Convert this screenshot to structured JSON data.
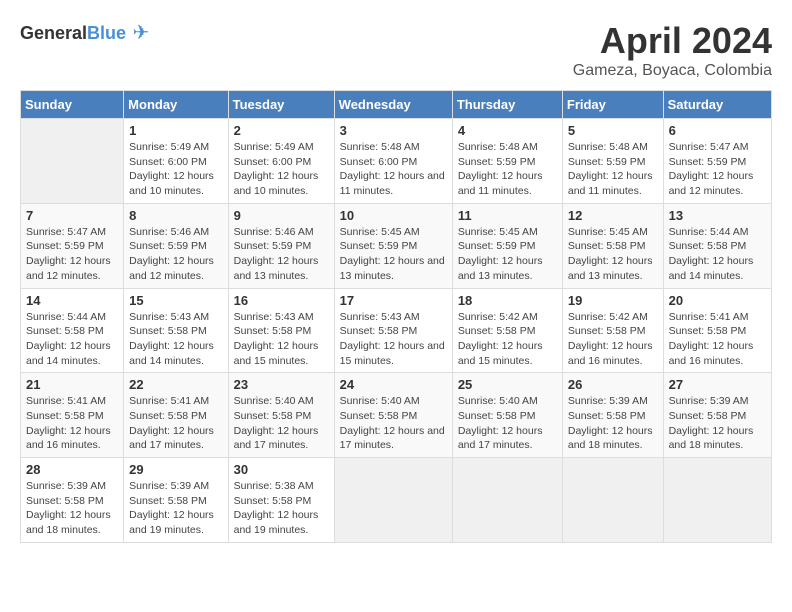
{
  "header": {
    "logo_general": "General",
    "logo_blue": "Blue",
    "month_year": "April 2024",
    "location": "Gameza, Boyaca, Colombia"
  },
  "days_of_week": [
    "Sunday",
    "Monday",
    "Tuesday",
    "Wednesday",
    "Thursday",
    "Friday",
    "Saturday"
  ],
  "weeks": [
    [
      {
        "day": "",
        "empty": true
      },
      {
        "day": "1",
        "sunrise": "5:49 AM",
        "sunset": "6:00 PM",
        "daylight": "12 hours and 10 minutes."
      },
      {
        "day": "2",
        "sunrise": "5:49 AM",
        "sunset": "6:00 PM",
        "daylight": "12 hours and 10 minutes."
      },
      {
        "day": "3",
        "sunrise": "5:48 AM",
        "sunset": "6:00 PM",
        "daylight": "12 hours and 11 minutes."
      },
      {
        "day": "4",
        "sunrise": "5:48 AM",
        "sunset": "5:59 PM",
        "daylight": "12 hours and 11 minutes."
      },
      {
        "day": "5",
        "sunrise": "5:48 AM",
        "sunset": "5:59 PM",
        "daylight": "12 hours and 11 minutes."
      },
      {
        "day": "6",
        "sunrise": "5:47 AM",
        "sunset": "5:59 PM",
        "daylight": "12 hours and 12 minutes."
      }
    ],
    [
      {
        "day": "7",
        "sunrise": "5:47 AM",
        "sunset": "5:59 PM",
        "daylight": "12 hours and 12 minutes."
      },
      {
        "day": "8",
        "sunrise": "5:46 AM",
        "sunset": "5:59 PM",
        "daylight": "12 hours and 12 minutes."
      },
      {
        "day": "9",
        "sunrise": "5:46 AM",
        "sunset": "5:59 PM",
        "daylight": "12 hours and 13 minutes."
      },
      {
        "day": "10",
        "sunrise": "5:45 AM",
        "sunset": "5:59 PM",
        "daylight": "12 hours and 13 minutes."
      },
      {
        "day": "11",
        "sunrise": "5:45 AM",
        "sunset": "5:59 PM",
        "daylight": "12 hours and 13 minutes."
      },
      {
        "day": "12",
        "sunrise": "5:45 AM",
        "sunset": "5:58 PM",
        "daylight": "12 hours and 13 minutes."
      },
      {
        "day": "13",
        "sunrise": "5:44 AM",
        "sunset": "5:58 PM",
        "daylight": "12 hours and 14 minutes."
      }
    ],
    [
      {
        "day": "14",
        "sunrise": "5:44 AM",
        "sunset": "5:58 PM",
        "daylight": "12 hours and 14 minutes."
      },
      {
        "day": "15",
        "sunrise": "5:43 AM",
        "sunset": "5:58 PM",
        "daylight": "12 hours and 14 minutes."
      },
      {
        "day": "16",
        "sunrise": "5:43 AM",
        "sunset": "5:58 PM",
        "daylight": "12 hours and 15 minutes."
      },
      {
        "day": "17",
        "sunrise": "5:43 AM",
        "sunset": "5:58 PM",
        "daylight": "12 hours and 15 minutes."
      },
      {
        "day": "18",
        "sunrise": "5:42 AM",
        "sunset": "5:58 PM",
        "daylight": "12 hours and 15 minutes."
      },
      {
        "day": "19",
        "sunrise": "5:42 AM",
        "sunset": "5:58 PM",
        "daylight": "12 hours and 16 minutes."
      },
      {
        "day": "20",
        "sunrise": "5:41 AM",
        "sunset": "5:58 PM",
        "daylight": "12 hours and 16 minutes."
      }
    ],
    [
      {
        "day": "21",
        "sunrise": "5:41 AM",
        "sunset": "5:58 PM",
        "daylight": "12 hours and 16 minutes."
      },
      {
        "day": "22",
        "sunrise": "5:41 AM",
        "sunset": "5:58 PM",
        "daylight": "12 hours and 17 minutes."
      },
      {
        "day": "23",
        "sunrise": "5:40 AM",
        "sunset": "5:58 PM",
        "daylight": "12 hours and 17 minutes."
      },
      {
        "day": "24",
        "sunrise": "5:40 AM",
        "sunset": "5:58 PM",
        "daylight": "12 hours and 17 minutes."
      },
      {
        "day": "25",
        "sunrise": "5:40 AM",
        "sunset": "5:58 PM",
        "daylight": "12 hours and 17 minutes."
      },
      {
        "day": "26",
        "sunrise": "5:39 AM",
        "sunset": "5:58 PM",
        "daylight": "12 hours and 18 minutes."
      },
      {
        "day": "27",
        "sunrise": "5:39 AM",
        "sunset": "5:58 PM",
        "daylight": "12 hours and 18 minutes."
      }
    ],
    [
      {
        "day": "28",
        "sunrise": "5:39 AM",
        "sunset": "5:58 PM",
        "daylight": "12 hours and 18 minutes."
      },
      {
        "day": "29",
        "sunrise": "5:39 AM",
        "sunset": "5:58 PM",
        "daylight": "12 hours and 19 minutes."
      },
      {
        "day": "30",
        "sunrise": "5:38 AM",
        "sunset": "5:58 PM",
        "daylight": "12 hours and 19 minutes."
      },
      {
        "day": "",
        "empty": true
      },
      {
        "day": "",
        "empty": true
      },
      {
        "day": "",
        "empty": true
      },
      {
        "day": "",
        "empty": true
      }
    ]
  ],
  "labels": {
    "sunrise": "Sunrise:",
    "sunset": "Sunset:",
    "daylight": "Daylight:"
  }
}
